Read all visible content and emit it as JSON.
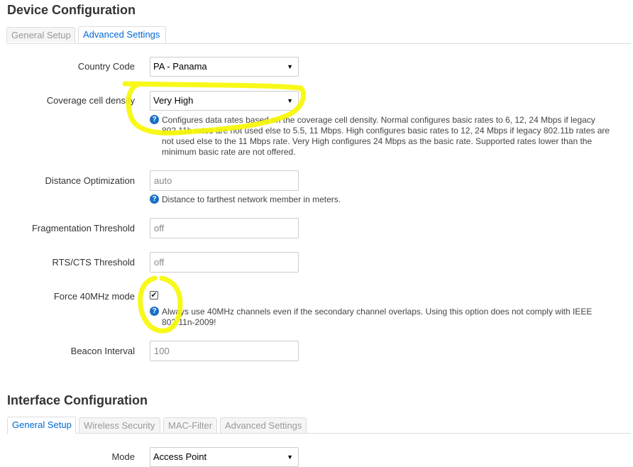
{
  "device_config": {
    "title": "Device Configuration",
    "tabs": [
      {
        "label": "General Setup",
        "active": false
      },
      {
        "label": "Advanced Settings",
        "active": true
      }
    ],
    "fields": {
      "country_code": {
        "label": "Country Code",
        "value": "PA - Panama"
      },
      "coverage_density": {
        "label": "Coverage cell density",
        "value": "Very High",
        "help": "Configures data rates based on the coverage cell density. Normal configures basic rates to 6, 12, 24 Mbps if legacy 802.11b rates are not used else to 5.5, 11 Mbps. High configures basic rates to 12, 24 Mbps if legacy 802.11b rates are not used else to the 11 Mbps rate. Very High configures 24 Mbps as the basic rate. Supported rates lower than the minimum basic rate are not offered."
      },
      "distance_optimization": {
        "label": "Distance Optimization",
        "placeholder": "auto",
        "help": "Distance to farthest network member in meters."
      },
      "fragmentation_threshold": {
        "label": "Fragmentation Threshold",
        "placeholder": "off"
      },
      "rts_cts_threshold": {
        "label": "RTS/CTS Threshold",
        "placeholder": "off"
      },
      "force_40mhz": {
        "label": "Force 40MHz mode",
        "checked": true,
        "help": "Always use 40MHz channels even if the secondary channel overlaps. Using this option does not comply with IEEE 802.11n-2009!"
      },
      "beacon_interval": {
        "label": "Beacon Interval",
        "placeholder": "100"
      }
    }
  },
  "interface_config": {
    "title": "Interface Configuration",
    "tabs": [
      {
        "label": "General Setup",
        "active": true
      },
      {
        "label": "Wireless Security",
        "active": false
      },
      {
        "label": "MAC-Filter",
        "active": false
      },
      {
        "label": "Advanced Settings",
        "active": false
      }
    ],
    "fields": {
      "mode": {
        "label": "Mode",
        "value": "Access Point"
      }
    }
  },
  "icons": {
    "help": "question-circle-icon",
    "caret": "caret-down-icon",
    "check": "check-icon"
  },
  "colors": {
    "highlight": "#f7f700",
    "active_tab": "#0069d6",
    "help_icon": "#1a6fc4"
  }
}
